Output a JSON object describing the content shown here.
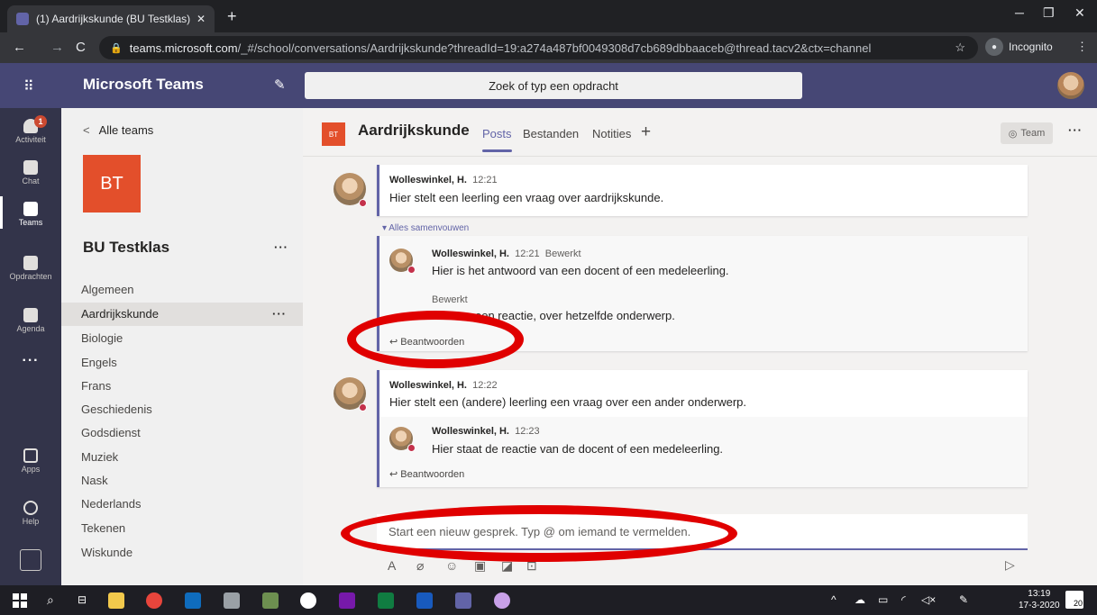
{
  "browser": {
    "tab_title": "(1) Aardrijkskunde (BU Testklas) |",
    "url_host": "teams.microsoft.com",
    "url_path": "/_#/school/conversations/Aardrijkskunde?threadId=19:a274a487bf0049308d7cb689dbbaaceb@thread.tacv2&ctx=channel",
    "incognito_label": "Incognito"
  },
  "teams": {
    "brand": "Microsoft Teams",
    "search_placeholder": "Zoek of typ een opdracht"
  },
  "rail": [
    {
      "label": "Activiteit",
      "icon": "bell-icon",
      "badge": "1"
    },
    {
      "label": "Chat",
      "icon": "chat-icon"
    },
    {
      "label": "Teams",
      "icon": "teams-icon",
      "active": true
    },
    {
      "label": "Opdrachten",
      "icon": "assignments-icon"
    },
    {
      "label": "Agenda",
      "icon": "calendar-icon"
    },
    {
      "label": "Apps",
      "icon": "apps-icon"
    },
    {
      "label": "Help",
      "icon": "help-icon"
    }
  ],
  "sidebar": {
    "back_label": "Alle teams",
    "team_initials": "BT",
    "team_name": "BU Testklas",
    "channels": [
      "Algemeen",
      "Aardrijkskunde",
      "Biologie",
      "Engels",
      "Frans",
      "Geschiedenis",
      "Godsdienst",
      "Muziek",
      "Nask",
      "Nederlands",
      "Tekenen",
      "Wiskunde"
    ],
    "selected_channel": "Aardrijkskunde"
  },
  "channel_header": {
    "tile": "BT",
    "name": "Aardrijkskunde",
    "tabs": [
      "Posts",
      "Bestanden",
      "Notities"
    ],
    "active_tab": "Posts",
    "team_button": "Team"
  },
  "conversation": {
    "thread1": {
      "author": "Wolleswinkel, H.",
      "time": "12:21",
      "text": "Hier stelt een leerling een vraag over aardrijkskunde.",
      "collapse_label": "Alles samenvouwen",
      "reply1": {
        "author": "Wolleswinkel, H.",
        "time": "12:21",
        "edited": "Bewerkt",
        "text": "Hier is het antwoord van een docent of een medeleerling."
      },
      "reply2": {
        "edited": "Bewerkt",
        "text_visible": "een reactie, over hetzelfde onderwerp."
      },
      "reply_label": "Beantwoorden"
    },
    "thread2": {
      "author": "Wolleswinkel, H.",
      "time": "12:22",
      "text": "Hier stelt een (andere) leerling een vraag over een ander onderwerp.",
      "reply1": {
        "author": "Wolleswinkel, H.",
        "time": "12:23",
        "text": "Hier staat de reactie van de docent of een medeleerling."
      },
      "reply_label": "Beantwoorden"
    },
    "compose_placeholder": "Start een nieuw gesprek. Typ @ om iemand te vermelden."
  },
  "taskbar": {
    "time": "13:19",
    "date": "17-3-2020",
    "notifications": "20"
  },
  "colors": {
    "teams_purple": "#464775",
    "accent": "#6264a7",
    "team_tile": "#e34f2b",
    "annotation_red": "#e00000"
  }
}
